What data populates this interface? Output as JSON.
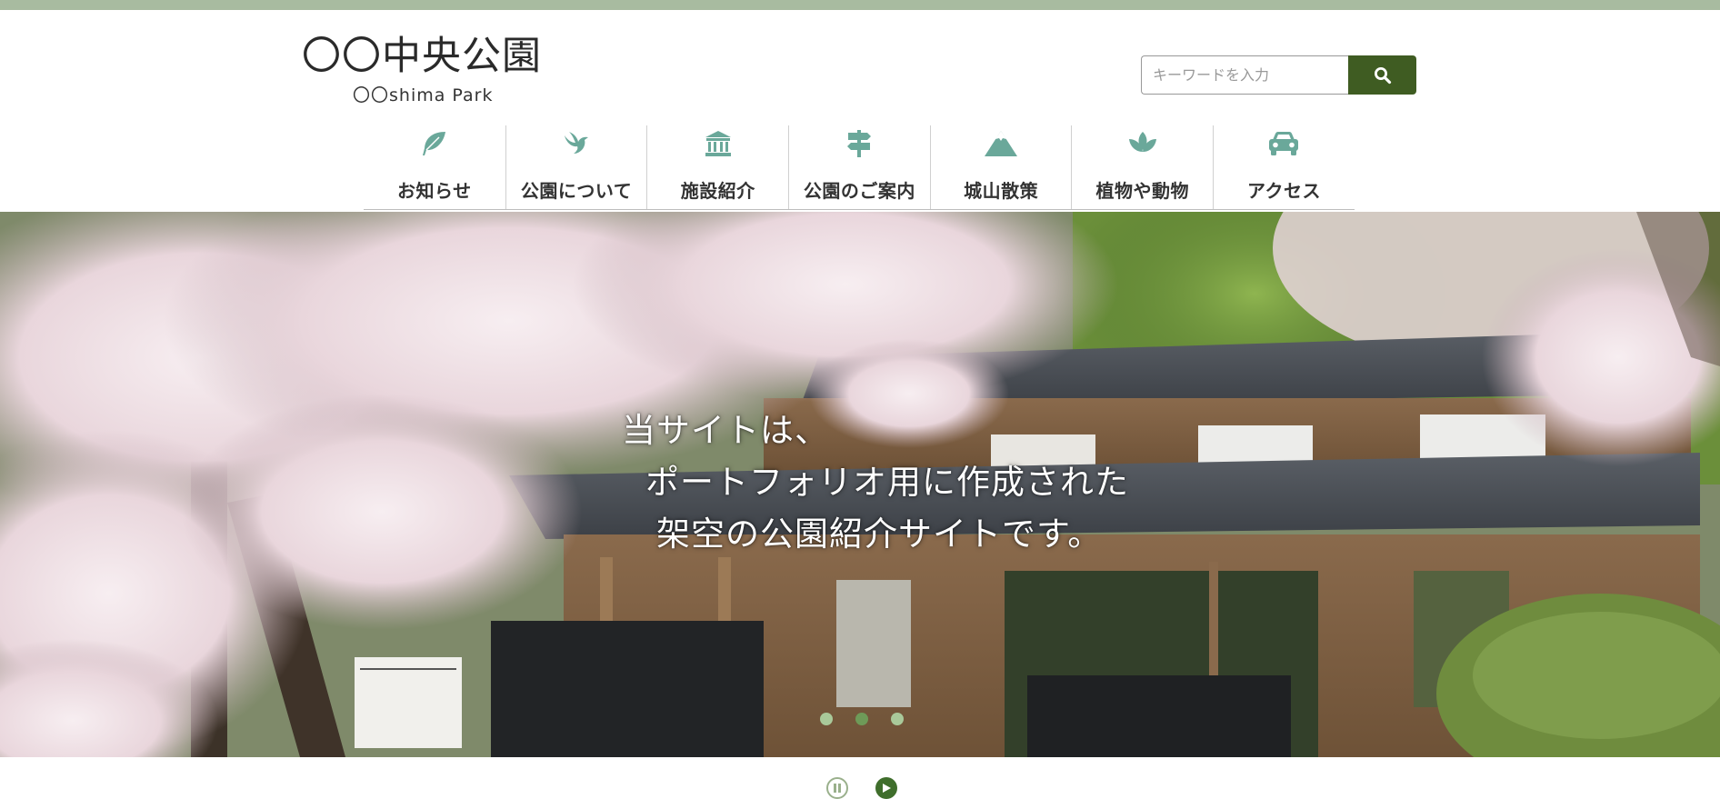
{
  "header": {
    "logo_title": "〇〇中央公園",
    "logo_subtitle": "〇〇shima Park"
  },
  "search": {
    "placeholder": "キーワードを入力",
    "button_icon": "search-icon"
  },
  "nav": {
    "items": [
      {
        "label": "お知らせ",
        "icon": "leaf-icon"
      },
      {
        "label": "公園について",
        "icon": "bird-icon"
      },
      {
        "label": "施設紹介",
        "icon": "building-icon"
      },
      {
        "label": "公園のご案内",
        "icon": "signpost-icon"
      },
      {
        "label": "城山散策",
        "icon": "mountain-icon"
      },
      {
        "label": "植物や動物",
        "icon": "plant-icon"
      },
      {
        "label": "アクセス",
        "icon": "car-icon"
      }
    ]
  },
  "hero": {
    "line1": "当サイトは、",
    "line2": "ポートフォリオ用に作成された",
    "line3": "架空の公園紹介サイトです。",
    "slide_count": 3,
    "active_slide": 2
  },
  "slider_controls": {
    "pause_icon": "pause-icon",
    "play_icon": "play-icon"
  },
  "colors": {
    "accent_green": "#3f5c22",
    "icon_teal": "#6aa89a",
    "top_bar": "#a8bba0"
  }
}
